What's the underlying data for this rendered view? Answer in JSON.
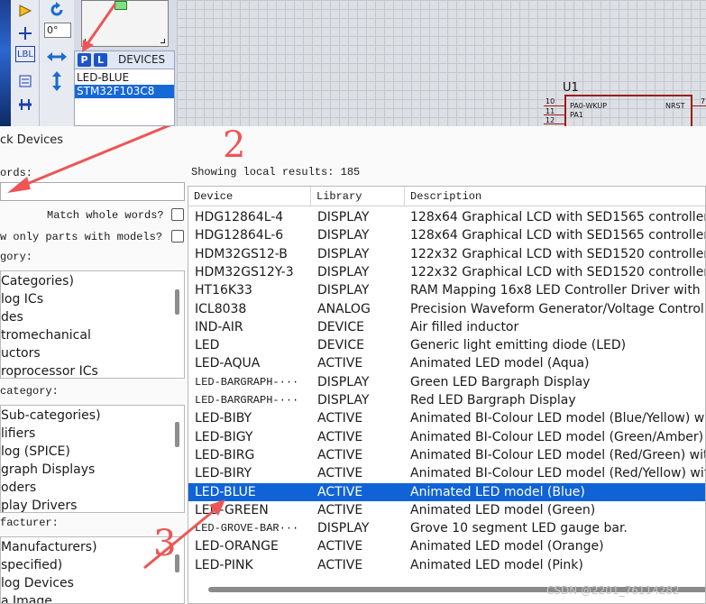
{
  "isis": {
    "angle_value": "0°",
    "devices_panel": {
      "p_button": "P",
      "l_button": "L",
      "header_label": "DEVICES",
      "items": [
        "LED-BLUE",
        "STM32F103C8"
      ]
    },
    "component": {
      "ref": "U1",
      "pins": [
        {
          "num": "10",
          "name": "PA0-WKUP"
        },
        {
          "num": "11",
          "name": "PA1"
        },
        {
          "num": "12",
          "name": ""
        }
      ],
      "right_pin_name": "NRST",
      "right_pin_num": "7"
    },
    "toolbar_icons": [
      "terminal-icon",
      "probe-icon",
      "label-icon",
      "bus-icon",
      "rotate-icon",
      "mirror-horizontal-icon",
      "mirror-vertical-icon"
    ],
    "lbl_text": "LBL"
  },
  "dialog": {
    "title": "ck Devices",
    "keywords_label": "ords:",
    "keywords_value": "",
    "match_whole_words": "Match whole words?",
    "show_only_models": "w only parts with models?",
    "category_label": "gory:",
    "categories": [
      "Categories)",
      "log ICs",
      "des",
      "tromechanical",
      "uctors",
      "roprocessor ICs"
    ],
    "subcategory_label": "category:",
    "subcategories": [
      "Sub-categories)",
      "lifiers",
      "log (SPICE)",
      "graph Displays",
      "oders",
      "play Drivers"
    ],
    "manufacturer_label": "facturer:",
    "manufacturers": [
      "Manufacturers)",
      "specified)",
      "log Devices",
      "a Image"
    ],
    "results_count": "Showing local results: 185",
    "columns": {
      "device": "Device",
      "library": "Library",
      "description": "Description"
    },
    "rows": [
      {
        "device": "HDG12864L-4",
        "library": "DISPLAY",
        "description": "128x64 Graphical LCD with SED1565 controller, Pa"
      },
      {
        "device": "HDG12864L-6",
        "library": "DISPLAY",
        "description": "128x64 Graphical LCD with SED1565 controller, Se"
      },
      {
        "device": "HDM32GS12-B",
        "library": "DISPLAY",
        "description": "122x32 Graphical LCD with SED1520 controllers, L"
      },
      {
        "device": "HDM32GS12Y-3",
        "library": "DISPLAY",
        "description": "122x32 Graphical LCD with SED1520 controllers, S"
      },
      {
        "device": "HT16K33",
        "library": "DISPLAY",
        "description": "RAM Mapping 16x8 LED Controller Driver with ke"
      },
      {
        "device": "ICL8038",
        "library": "ANALOG",
        "description": "Precision Waveform Generator/Voltage Controlle"
      },
      {
        "device": "IND-AIR",
        "library": "DEVICE",
        "description": "Air filled inductor"
      },
      {
        "device": "LED",
        "library": "DEVICE",
        "description": "Generic light emitting diode (LED)"
      },
      {
        "device": "LED-AQUA",
        "library": "ACTIVE",
        "description": "Animated LED model (Aqua)"
      },
      {
        "device": "LED-BARGRAPH-···",
        "library": "DISPLAY",
        "description": "Green LED Bargraph Display"
      },
      {
        "device": "LED-BARGRAPH-···",
        "library": "DISPLAY",
        "description": "Red LED Bargraph Display"
      },
      {
        "device": "LED-BIBY",
        "library": "ACTIVE",
        "description": "Animated BI-Colour LED model (Blue/Yellow) with"
      },
      {
        "device": "LED-BIGY",
        "library": "ACTIVE",
        "description": "Animated BI-Colour LED model (Green/Amber) wi"
      },
      {
        "device": "LED-BIRG",
        "library": "ACTIVE",
        "description": "Animated BI-Colour LED model (Red/Green) with"
      },
      {
        "device": "LED-BIRY",
        "library": "ACTIVE",
        "description": "Animated BI-Colour LED model (Red/Yellow) with"
      },
      {
        "device": "LED-BLUE",
        "library": "ACTIVE",
        "description": "Animated LED model (Blue)"
      },
      {
        "device": "LED-GREEN",
        "library": "ACTIVE",
        "description": "Animated LED model (Green)"
      },
      {
        "device": "LED-GROVE-BAR···",
        "library": "DISPLAY",
        "description": "Grove 10 segment LED gauge bar."
      },
      {
        "device": "LED-ORANGE",
        "library": "ACTIVE",
        "description": "Animated LED model (Orange)"
      },
      {
        "device": "LED-PINK",
        "library": "ACTIVE",
        "description": "Animated LED model (Pink)"
      }
    ],
    "selected_row_index": 15
  },
  "annotations": {
    "step2": "2",
    "step3": "3"
  },
  "watermark": "CSDN @2201_76114282",
  "colors": {
    "selection": "#0f63d6",
    "annotation": "#ee5555",
    "ic_outline": "#9e1b1b"
  }
}
